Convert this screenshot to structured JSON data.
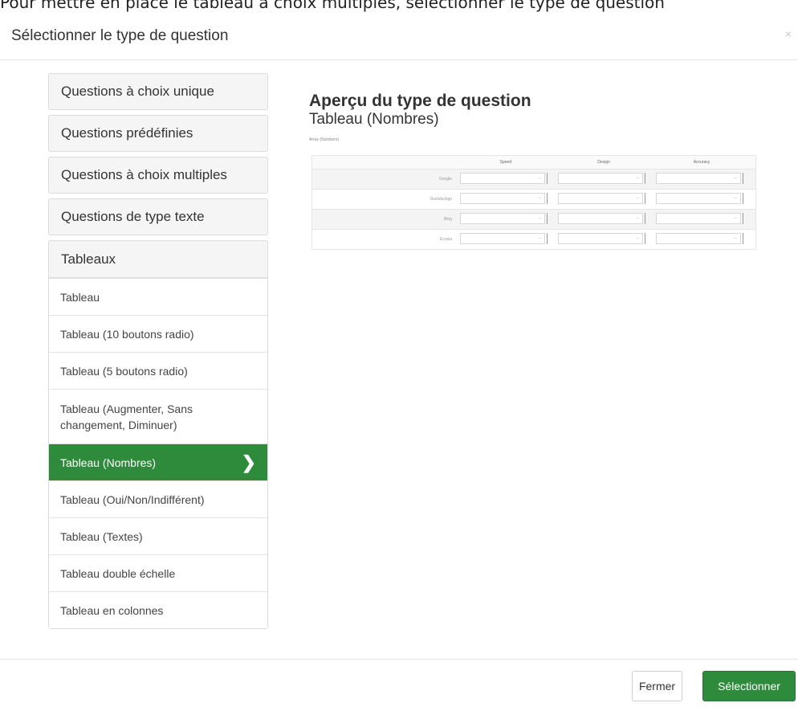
{
  "top_caption": "Pour mettre en place le tableau à choix multiples, sélectionner le type de question",
  "modal": {
    "title": "Sélectionner le type de question",
    "close_icon": "×"
  },
  "categories": [
    {
      "label": "Questions à choix unique"
    },
    {
      "label": "Questions prédéfinies"
    },
    {
      "label": "Questions à choix multiples"
    },
    {
      "label": "Questions de type texte"
    }
  ],
  "open_category": {
    "label": "Tableaux",
    "items": [
      {
        "label": "Tableau"
      },
      {
        "label": "Tableau (10 boutons radio)"
      },
      {
        "label": "Tableau (5 boutons radio)"
      },
      {
        "label": "Tableau (Augmenter, Sans changement, Diminuer)"
      },
      {
        "label": "Tableau (Nombres)",
        "selected": true
      },
      {
        "label": "Tableau (Oui/Non/Indifférent)"
      },
      {
        "label": "Tableau (Textes)"
      },
      {
        "label": "Tableau double échelle"
      },
      {
        "label": "Tableau en colonnes"
      }
    ]
  },
  "preview": {
    "heading": "Aperçu du type de question",
    "type_name": "Tableau (Nombres)",
    "question_label": "Array (Numbers)",
    "columns": [
      "Speed",
      "Design",
      "Accuracy"
    ],
    "rows": [
      "Google",
      "Duckduckgo",
      "Bing",
      "Ecosia"
    ],
    "input_value": "–"
  },
  "footer": {
    "close_label": "Fermer",
    "select_label": "Sélectionner"
  },
  "colors": {
    "accent": "#2e8b3c"
  }
}
